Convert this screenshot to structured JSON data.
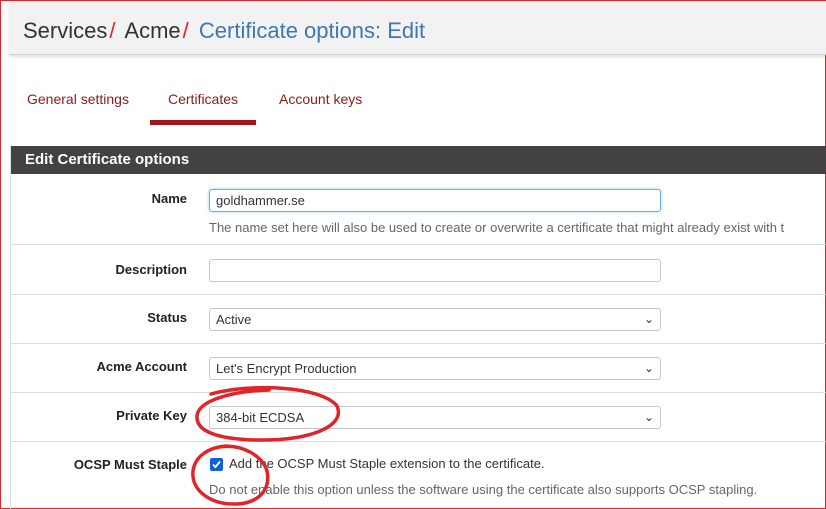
{
  "breadcrumb": {
    "items": [
      "Services",
      "Acme"
    ],
    "separator": "/",
    "current": "Certificate options: Edit"
  },
  "tabs": [
    {
      "label": "General settings",
      "active": false
    },
    {
      "label": "Certificates",
      "active": true
    },
    {
      "label": "Account keys",
      "active": false
    }
  ],
  "panel": {
    "title": "Edit Certificate options"
  },
  "form": {
    "name": {
      "label": "Name",
      "value": "goldhammer.se",
      "help": "The name set here will also be used to create or overwrite a certificate that might already exist with t"
    },
    "description": {
      "label": "Description",
      "value": ""
    },
    "status": {
      "label": "Status",
      "value": "Active"
    },
    "acme_account": {
      "label": "Acme Account",
      "value": "Let's Encrypt Production"
    },
    "private_key": {
      "label": "Private Key",
      "value": "384-bit ECDSA"
    },
    "ocsp": {
      "label": "OCSP Must Staple",
      "checked": true,
      "checkbox_label": "Add the OCSP Must Staple extension to the certificate.",
      "help": "Do not enable this option unless the software using the certificate also supports OCSP stapling."
    }
  },
  "colors": {
    "accent": "#a0161c",
    "annotation": "#e0242a",
    "panel_heading": "#424242",
    "checkbox": "#0b63d6"
  }
}
